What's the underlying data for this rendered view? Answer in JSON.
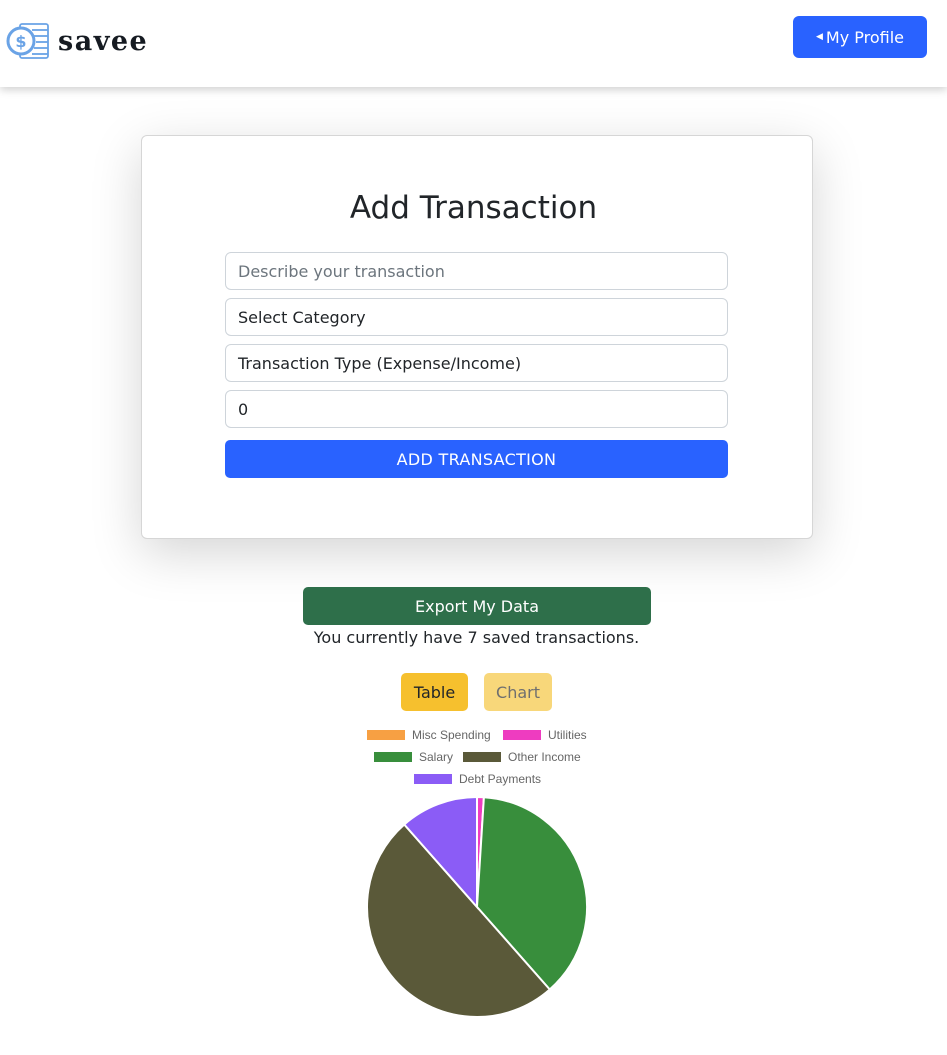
{
  "header": {
    "brand_name": "savee",
    "profile_button": "My Profile"
  },
  "form": {
    "title": "Add Transaction",
    "description_placeholder": "Describe your transaction",
    "category_value": "Select Category",
    "type_value": "Transaction Type (Expense/Income)",
    "amount_value": "0",
    "submit_label": "ADD TRANSACTION"
  },
  "actions": {
    "export_label": "Export My Data",
    "count_text": "You currently have 7 saved transactions.",
    "view_table": "Table",
    "view_chart": "Chart"
  },
  "colors": {
    "primary": "#2962ff",
    "export_green": "#2e6f4a",
    "toggle_active": "#f6c02e",
    "toggle_inactive": "#f8d77a"
  },
  "chart_data": {
    "type": "pie",
    "legend_position": "top",
    "categories": [
      "Misc Spending",
      "Utilities",
      "Salary",
      "Other Income",
      "Debt Payments"
    ],
    "values": [
      0,
      1,
      37.5,
      50,
      11.5
    ],
    "colors": [
      "#f7a043",
      "#ee3cc0",
      "#388e3c",
      "#5a5939",
      "#8b5cf6"
    ]
  }
}
